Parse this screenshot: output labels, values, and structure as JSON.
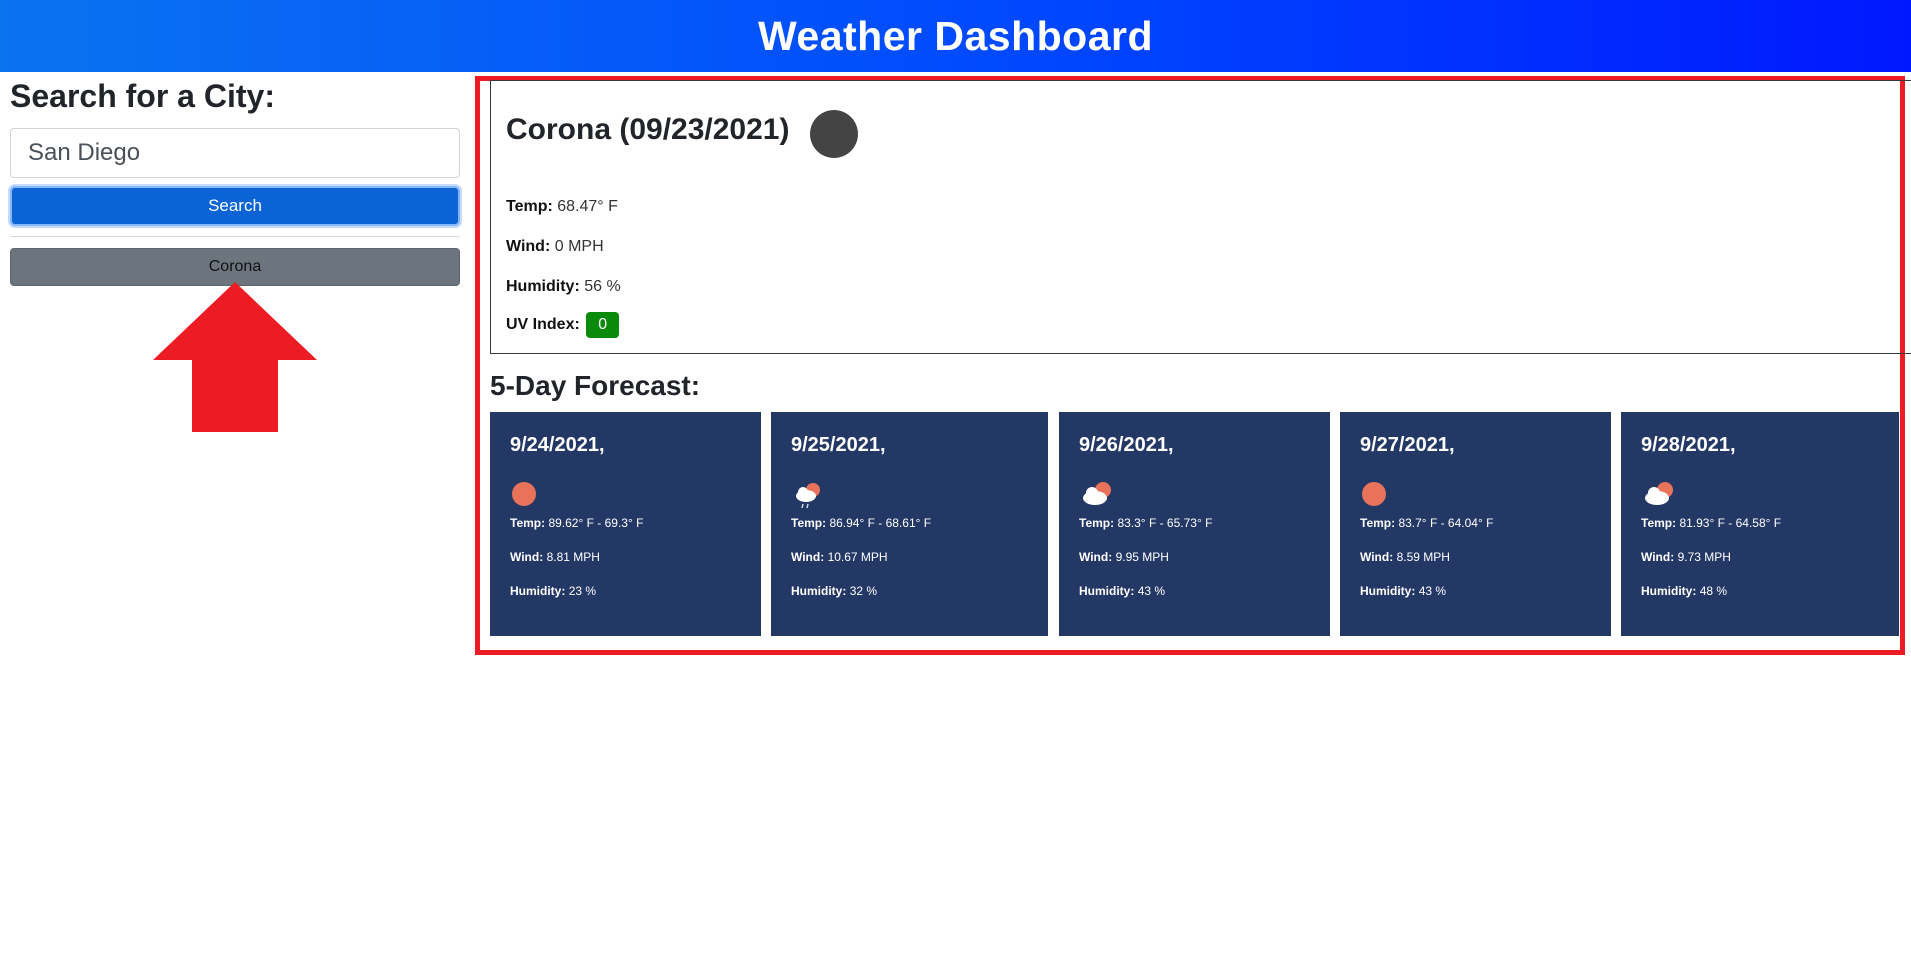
{
  "header": {
    "title": "Weather Dashboard"
  },
  "sidebar": {
    "heading": "Search for a City:",
    "search_value": "San Diego",
    "search_button": "Search",
    "history": [
      "Corona"
    ]
  },
  "current": {
    "title": "Corona (09/23/2021)",
    "icon": "night-clear-icon",
    "temp_label": "Temp:",
    "temp_value": "68.47° F",
    "wind_label": "Wind:",
    "wind_value": "0 MPH",
    "humidity_label": "Humidity:",
    "humidity_value": "56 %",
    "uv_label": "UV Index:",
    "uv_value": "0",
    "uv_color": "#0a8a0a"
  },
  "forecast": {
    "title": "5-Day Forecast:",
    "temp_label": "Temp:",
    "wind_label": "Wind:",
    "humidity_label": "Humidity:",
    "days": [
      {
        "date": "9/24/2021,",
        "icon": "sun-icon",
        "temp": "89.62° F - 69.3° F",
        "wind": "8.81 MPH",
        "humidity": "23 %"
      },
      {
        "date": "9/25/2021,",
        "icon": "cloud-rain-sun-icon",
        "temp": "86.94° F - 68.61° F",
        "wind": "10.67 MPH",
        "humidity": "32 %"
      },
      {
        "date": "9/26/2021,",
        "icon": "cloud-sun-icon",
        "temp": "83.3° F - 65.73° F",
        "wind": "9.95 MPH",
        "humidity": "43 %"
      },
      {
        "date": "9/27/2021,",
        "icon": "sun-icon",
        "temp": "83.7° F - 64.04° F",
        "wind": "8.59 MPH",
        "humidity": "43 %"
      },
      {
        "date": "9/28/2021,",
        "icon": "cloud-sun-icon",
        "temp": "81.93° F - 64.58° F",
        "wind": "9.73 MPH",
        "humidity": "48 %"
      }
    ]
  },
  "colors": {
    "header_gradient_start": "#0a73f0",
    "header_gradient_end": "#0018ff",
    "forecast_card": "#243866",
    "annotation_red": "#ed1c24",
    "sun": "#e8735a"
  }
}
